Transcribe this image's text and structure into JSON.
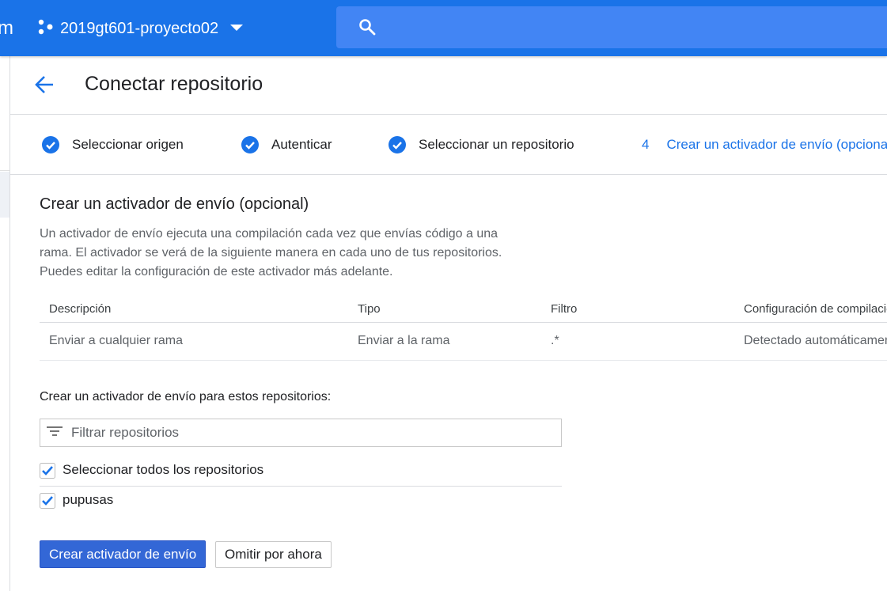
{
  "topbar": {
    "app_fragment": "m",
    "project_name": "2019gt601-proyecto02",
    "search_placeholder": ""
  },
  "header": {
    "title": "Conectar repositorio"
  },
  "stepper": {
    "steps": [
      {
        "label": "Seleccionar origen",
        "done": true
      },
      {
        "label": "Autenticar",
        "done": true
      },
      {
        "label": "Seleccionar un repositorio",
        "done": true
      },
      {
        "number": "4",
        "label": "Crear un activador de envío (opcional)",
        "done": false,
        "active": true
      }
    ]
  },
  "section": {
    "title": "Crear un activador de envío (opcional)",
    "description_lines": [
      "Un activador de envío ejecuta una compilación cada vez que envías código a una",
      "rama. El activador se verá de la siguiente manera en cada uno de tus repositorios.",
      "Puedes editar la configuración de este activador más adelante."
    ]
  },
  "table": {
    "headers": [
      "Descripción",
      "Tipo",
      "Filtro",
      "Configuración de compilación"
    ],
    "rows": [
      [
        "Enviar a cualquier rama",
        "Enviar a la rama",
        ".*",
        "Detectado automáticamente"
      ]
    ]
  },
  "repos": {
    "label": "Crear un activador de envío para estos repositorios:",
    "filter_placeholder": "Filtrar repositorios",
    "select_all_label": "Seleccionar todos los repositorios",
    "select_all_checked": true,
    "items": [
      {
        "name": "pupusas",
        "checked": true
      }
    ]
  },
  "actions": {
    "primary_label": "Crear activador de envío",
    "secondary_label": "Omitir por ahora"
  },
  "colors": {
    "brand": "#1a73e8",
    "primary_button": "#3367d6"
  }
}
